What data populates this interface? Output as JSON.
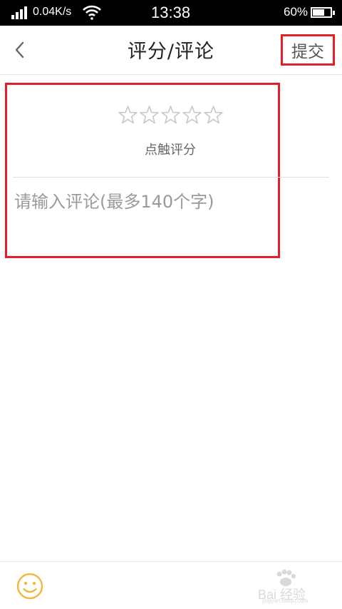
{
  "status_bar": {
    "net_speed": "0.04K/s",
    "time": "13:38",
    "battery_percent": "60%",
    "battery_level": 0.6
  },
  "header": {
    "title": "评分/评论",
    "submit_label": "提交",
    "back_icon": "chevron-left-icon"
  },
  "rating": {
    "star_count": 5,
    "selected": 0,
    "tap_label": "点触评分"
  },
  "comment": {
    "value": "",
    "placeholder": "请输入评论(最多140个字)"
  },
  "bottom_bar": {
    "emoji_icon": "smiley-icon",
    "watermark_text": "Bai 经验",
    "watermark_sub": "jingyan.baidu.com"
  },
  "colors": {
    "highlight": "#e3202a",
    "emoji": "#f0b93b",
    "star_outline": "#c8c8c8"
  }
}
